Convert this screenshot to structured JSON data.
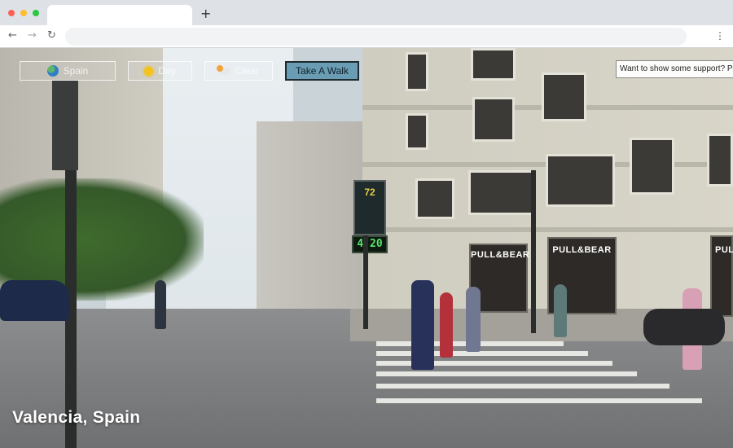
{
  "browser": {
    "new_tab_label": "+",
    "back_icon": "arrow-left-icon",
    "forward_icon": "arrow-right-icon",
    "reload_icon": "reload-icon",
    "menu_icon": "kebab-menu-icon",
    "url": ""
  },
  "controls": {
    "location": {
      "label": "Spain",
      "icon": "globe-icon"
    },
    "time": {
      "label": "Day",
      "icon": "sun-icon"
    },
    "weather": {
      "label": "Clear",
      "icon": "cloud-icon"
    },
    "walk_button": {
      "label": "Take A Walk",
      "color": "#6a9db4"
    }
  },
  "support_banner": {
    "text": "Want to show some support? Plea"
  },
  "scene": {
    "location_title": "Valencia, Spain",
    "shop_signs": [
      "PULL&BEAR",
      "PULL&BEAR",
      "PULL&"
    ],
    "clock_display": "4:20",
    "pharmacy_sign": "72"
  }
}
